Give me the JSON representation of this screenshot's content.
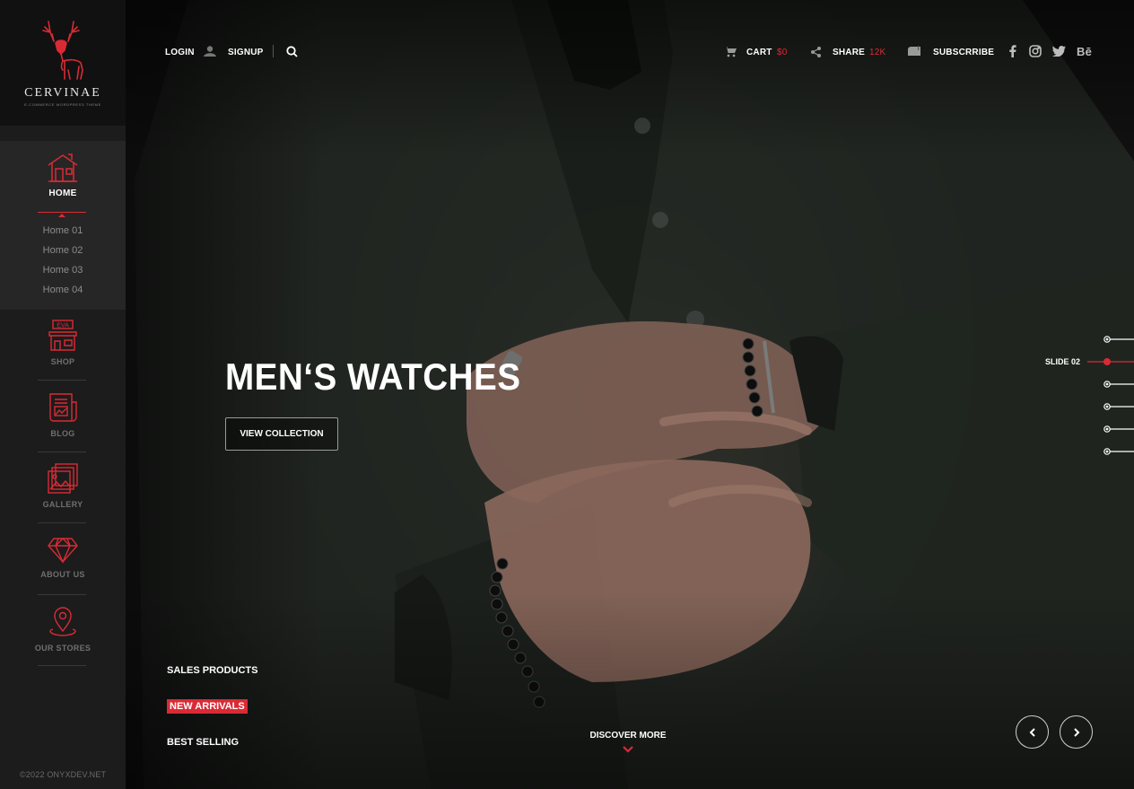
{
  "brand": {
    "name": "CERVINAE",
    "tagline": "E-COMMERCE WORDPRESS THEME"
  },
  "sidebar": {
    "home": {
      "label": "HOME",
      "icon": "house-icon"
    },
    "home_sub": [
      "Home 01",
      "Home 02",
      "Home 03",
      "Home 04"
    ],
    "items": [
      {
        "label": "SHOP",
        "icon": "storefront-icon"
      },
      {
        "label": "BLOG",
        "icon": "newspaper-icon"
      },
      {
        "label": "GALLERY",
        "icon": "gallery-icon"
      },
      {
        "label": "ABOUT US",
        "icon": "diamond-icon"
      },
      {
        "label": "OUR STORES",
        "icon": "map-pin-icon"
      }
    ],
    "shop_sign": "EVA",
    "copyright": "©2022 ONYXDEV.NET"
  },
  "topbar": {
    "login": "LOGIN",
    "signup": "SIGNUP",
    "cart_label": "CART",
    "cart_value": "$0",
    "share_label": "SHARE",
    "share_count": "12K",
    "subscribe_label": "SUBSCRRIBE",
    "social": [
      "facebook-icon",
      "instagram-icon",
      "twitter-icon",
      "behance-icon"
    ],
    "behance_text": "Bē"
  },
  "hero": {
    "title": "MEN‘S WATCHES",
    "button": "VIEW COLLECTION",
    "filters": [
      "SALES PRODUCTS",
      "NEW ARRIVALS",
      "BEST SELLING"
    ],
    "active_filter": "NEW ARRIVALS",
    "discover": "DISCOVER MORE",
    "active_slide_label": "SLIDE 02",
    "slide_count": 6,
    "active_slide_index": 1
  },
  "colors": {
    "accent": "#d92b35",
    "sidebar_bg": "#1c1c1c",
    "logo_bg": "#111111",
    "home_bg": "#262626"
  }
}
